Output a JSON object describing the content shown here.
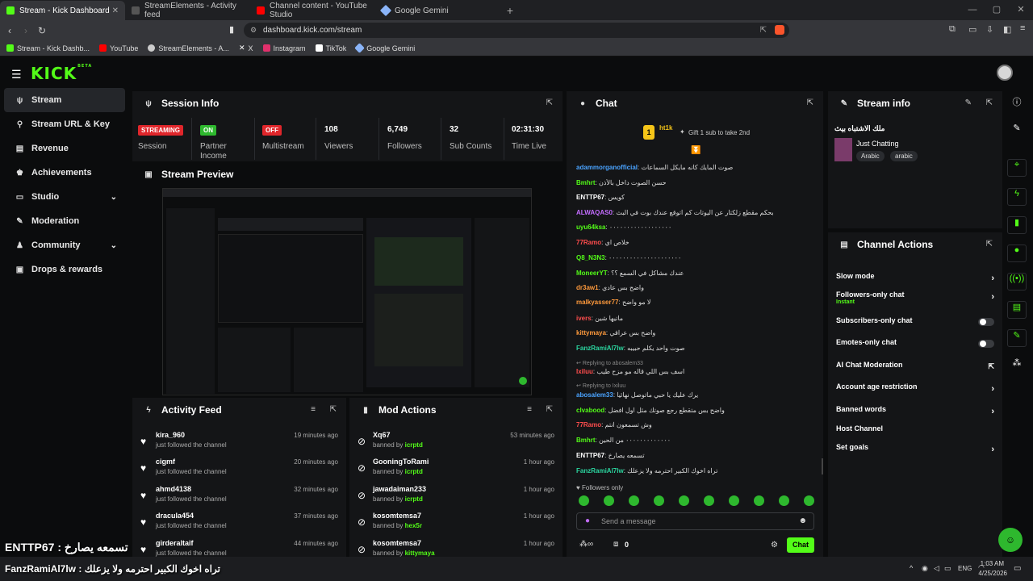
{
  "browser": {
    "tabs": [
      {
        "label": "Stream - Kick Dashboard",
        "color": "#53fc18",
        "active": true
      },
      {
        "label": "StreamElements - Activity feed",
        "color": "#555555",
        "active": false
      },
      {
        "label": "Channel content - YouTube Studio",
        "color": "#ff0000",
        "active": false
      },
      {
        "label": "Google Gemini",
        "color": "#8ab4f8",
        "active": false
      }
    ],
    "url": "dashboard.kick.com/stream",
    "bookmarks": [
      {
        "label": "Stream - Kick Dashb...",
        "color": "#53fc18"
      },
      {
        "label": "YouTube",
        "color": "#ff0000"
      },
      {
        "label": "StreamElements - A...",
        "color": "#cccccc"
      },
      {
        "label": "X",
        "color": "#ffffff"
      },
      {
        "label": "Instagram",
        "color": "#e1306c"
      },
      {
        "label": "TikTok",
        "color": "#ffffff"
      },
      {
        "label": "Google Gemini",
        "color": "#8ab4f8"
      }
    ]
  },
  "header": {
    "logo": "KICK",
    "logo_tag": "BETA"
  },
  "sidebar": {
    "items": [
      {
        "label": "Stream",
        "icon": "ψ"
      },
      {
        "label": "Stream URL & Key",
        "icon": "⚲"
      },
      {
        "label": "Revenue",
        "icon": "▤"
      },
      {
        "label": "Achievements",
        "icon": "♚"
      },
      {
        "label": "Studio",
        "icon": "▭"
      },
      {
        "label": "Moderation",
        "icon": "✎"
      },
      {
        "label": "Community",
        "icon": "♟"
      },
      {
        "label": "Drops & rewards",
        "icon": "▣"
      }
    ]
  },
  "session": {
    "title": "Session Info",
    "stats": [
      {
        "badge": "STREAMING",
        "badge_color": "#e0262b",
        "label": "Session"
      },
      {
        "badge": "ON",
        "badge_color": "#2eb82e",
        "label": "Partner Income"
      },
      {
        "badge": "OFF",
        "badge_color": "#e0262b",
        "label": "Multistream"
      },
      {
        "value": "108",
        "label": "Viewers"
      },
      {
        "value": "6,749",
        "label": "Followers"
      },
      {
        "value": "32",
        "label": "Sub Counts"
      },
      {
        "value": "02:31:30",
        "label": "Time Live"
      }
    ]
  },
  "preview": {
    "title": "Stream Preview"
  },
  "activity": {
    "title": "Activity Feed",
    "items": [
      {
        "name": "kira_960",
        "desc": "just followed the channel",
        "time": "19 minutes ago"
      },
      {
        "name": "cigmf",
        "desc": "just followed the channel",
        "time": "20 minutes ago"
      },
      {
        "name": "ahmd4138",
        "desc": "just followed the channel",
        "time": "32 minutes ago"
      },
      {
        "name": "dracula454",
        "desc": "just followed the channel",
        "time": "37 minutes ago"
      },
      {
        "name": "girderaltaif",
        "desc": "just followed the channel",
        "time": "44 minutes ago"
      }
    ]
  },
  "mod": {
    "title": "Mod Actions",
    "items": [
      {
        "name": "Xq67",
        "prefix": "banned by",
        "by": "icrptd",
        "time": "53 minutes ago"
      },
      {
        "name": "GooningToRami",
        "prefix": "banned by",
        "by": "icrptd",
        "time": "1 hour ago"
      },
      {
        "name": "jawadaiman233",
        "prefix": "banned by",
        "by": "icrptd",
        "time": "1 hour ago"
      },
      {
        "name": "kosomtemsa7",
        "prefix": "banned by",
        "by": "hex5r",
        "time": "1 hour ago"
      },
      {
        "name": "kosomtemsa7",
        "prefix": "banned by",
        "by": "kittymaya",
        "time": "1 hour ago"
      }
    ]
  },
  "chat": {
    "title": "Chat",
    "pinned_user": "ht1k",
    "pinned_rank": "1",
    "gift_text": "Gift 1 sub to take 2nd",
    "messages": [
      {
        "user": "adammorganofficial",
        "color": "#4aa3ff",
        "text": "صوت المايك كانه مايكل السماعات"
      },
      {
        "user": "Bmhrt",
        "color": "#53fc18",
        "text": "حسن الصوت داخل بالأذن"
      },
      {
        "user": "ENTTP67",
        "color": "#ffffff",
        "text": "كويس"
      },
      {
        "user": "ALWAQAS0",
        "color": "#c36cff",
        "text": "بحكم مقطع زلكتار عن اليوتات كم اتوقع عندك بوت في البث"
      },
      {
        "user": "uyu64ksa",
        "color": "#53fc18",
        "text": "٠٠٠٠٠٠٠٠٠٠٠٠٠٠٠٠٠٠"
      },
      {
        "user": "77Ramo",
        "color": "#ff4d4d",
        "text": "خلاص اي"
      },
      {
        "user": "Q8_N3N3",
        "color": "#53fc18",
        "text": "٠٠٠٠٠٠٠٠٠٠٠٠٠٠٠٠٠٠٠٠٠"
      },
      {
        "user": "MoneerYT",
        "color": "#53fc18",
        "text": "عندك مشاكل في السمع ؟؟"
      },
      {
        "user": "dr3aw1",
        "color": "#ff9a3c",
        "text": "واضح بس عادي"
      },
      {
        "user": "malkyasser77",
        "color": "#ff9a3c",
        "text": "لا مو واضح"
      },
      {
        "user": "ivers",
        "color": "#ff4d4d",
        "text": "ماتيها شين"
      },
      {
        "user": "kittymaya",
        "color": "#ff9a3c",
        "text": "واضح بس عراقي"
      },
      {
        "user": "FanzRamiAl7lw",
        "color": "#2bd6a0",
        "text": "صوت واحد يكلم حبيبه"
      },
      {
        "user": "Ixiluu",
        "color": "#ff4d4d",
        "text": "اسف بس اللي قاله مو مزح طيب"
      },
      {
        "user": "abosalem33",
        "color": "#4aa3ff",
        "text": "يرك عليك يا حبي ماتوصل نهائيا"
      },
      {
        "user": "clvabood",
        "color": "#53fc18",
        "text": "واضح بس متقطع رجع صوتك مثل اول افضل"
      },
      {
        "user": "77Ramo",
        "color": "#ff4d4d",
        "text": "وش تسمعون انتم"
      },
      {
        "user": "Bmhrt",
        "color": "#53fc18",
        "text": "٠٠٠٠٠٠٠٠٠٠٠٠٠ من الحين"
      },
      {
        "user": "ENTTP67",
        "color": "#ffffff",
        "text": "تسمعه يصارخ"
      },
      {
        "user": "FanzRamiAl7lw",
        "color": "#2bd6a0",
        "text": "تراه اخوك الكبير احترمه ولا يزعلك"
      }
    ],
    "reply1": "Replying to abosalem33",
    "reply2": "Replying to Ixiluu",
    "followers_only": "Followers only",
    "input_placeholder": "Send a message",
    "send_label": "Chat",
    "counter": "0"
  },
  "streaminfo": {
    "title": "Stream info",
    "stream_title": "ملك الاشتباه بيث",
    "category": "Just Chatting",
    "tags": [
      "Arabic",
      "arabic"
    ]
  },
  "actions": {
    "title": "Channel Actions",
    "items": [
      {
        "label": "Slow mode",
        "control": "arrow"
      },
      {
        "label": "Followers-only chat",
        "sub": "Instant",
        "control": "arrow"
      },
      {
        "label": "Subscribers-only chat",
        "control": "toggle"
      },
      {
        "label": "Emotes-only chat",
        "control": "toggle"
      },
      {
        "label": "AI Chat Moderation",
        "control": "popout"
      },
      {
        "label": "Account age restriction",
        "control": "arrow"
      },
      {
        "label": "Banned words",
        "control": "arrow"
      },
      {
        "label": "Host Channel",
        "control": "none"
      },
      {
        "label": "Set goals",
        "control": "arrow"
      }
    ]
  },
  "overlay": {
    "line1": "ENTTP67 : تسمعه يصارخ",
    "line2": "FanzRamiAl7lw : تراه اخوك الكبير احترمه ولا يزعلك"
  },
  "taskbar": {
    "lang": "ENG",
    "time": "1:03 AM",
    "date": "4/25/2026"
  }
}
